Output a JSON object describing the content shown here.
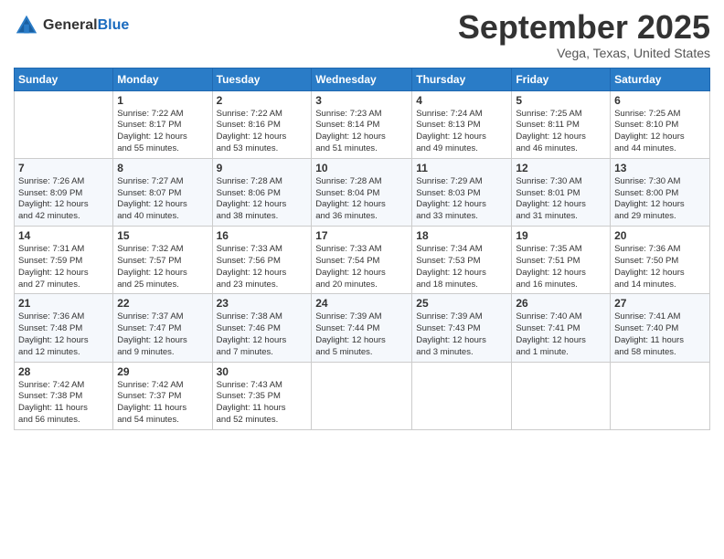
{
  "header": {
    "logo": {
      "general": "General",
      "blue": "Blue"
    },
    "title": "September 2025",
    "location": "Vega, Texas, United States"
  },
  "days_of_week": [
    "Sunday",
    "Monday",
    "Tuesday",
    "Wednesday",
    "Thursday",
    "Friday",
    "Saturday"
  ],
  "weeks": [
    [
      {
        "day": "",
        "info": ""
      },
      {
        "day": "1",
        "info": "Sunrise: 7:22 AM\nSunset: 8:17 PM\nDaylight: 12 hours\nand 55 minutes."
      },
      {
        "day": "2",
        "info": "Sunrise: 7:22 AM\nSunset: 8:16 PM\nDaylight: 12 hours\nand 53 minutes."
      },
      {
        "day": "3",
        "info": "Sunrise: 7:23 AM\nSunset: 8:14 PM\nDaylight: 12 hours\nand 51 minutes."
      },
      {
        "day": "4",
        "info": "Sunrise: 7:24 AM\nSunset: 8:13 PM\nDaylight: 12 hours\nand 49 minutes."
      },
      {
        "day": "5",
        "info": "Sunrise: 7:25 AM\nSunset: 8:11 PM\nDaylight: 12 hours\nand 46 minutes."
      },
      {
        "day": "6",
        "info": "Sunrise: 7:25 AM\nSunset: 8:10 PM\nDaylight: 12 hours\nand 44 minutes."
      }
    ],
    [
      {
        "day": "7",
        "info": "Sunrise: 7:26 AM\nSunset: 8:09 PM\nDaylight: 12 hours\nand 42 minutes."
      },
      {
        "day": "8",
        "info": "Sunrise: 7:27 AM\nSunset: 8:07 PM\nDaylight: 12 hours\nand 40 minutes."
      },
      {
        "day": "9",
        "info": "Sunrise: 7:28 AM\nSunset: 8:06 PM\nDaylight: 12 hours\nand 38 minutes."
      },
      {
        "day": "10",
        "info": "Sunrise: 7:28 AM\nSunset: 8:04 PM\nDaylight: 12 hours\nand 36 minutes."
      },
      {
        "day": "11",
        "info": "Sunrise: 7:29 AM\nSunset: 8:03 PM\nDaylight: 12 hours\nand 33 minutes."
      },
      {
        "day": "12",
        "info": "Sunrise: 7:30 AM\nSunset: 8:01 PM\nDaylight: 12 hours\nand 31 minutes."
      },
      {
        "day": "13",
        "info": "Sunrise: 7:30 AM\nSunset: 8:00 PM\nDaylight: 12 hours\nand 29 minutes."
      }
    ],
    [
      {
        "day": "14",
        "info": "Sunrise: 7:31 AM\nSunset: 7:59 PM\nDaylight: 12 hours\nand 27 minutes."
      },
      {
        "day": "15",
        "info": "Sunrise: 7:32 AM\nSunset: 7:57 PM\nDaylight: 12 hours\nand 25 minutes."
      },
      {
        "day": "16",
        "info": "Sunrise: 7:33 AM\nSunset: 7:56 PM\nDaylight: 12 hours\nand 23 minutes."
      },
      {
        "day": "17",
        "info": "Sunrise: 7:33 AM\nSunset: 7:54 PM\nDaylight: 12 hours\nand 20 minutes."
      },
      {
        "day": "18",
        "info": "Sunrise: 7:34 AM\nSunset: 7:53 PM\nDaylight: 12 hours\nand 18 minutes."
      },
      {
        "day": "19",
        "info": "Sunrise: 7:35 AM\nSunset: 7:51 PM\nDaylight: 12 hours\nand 16 minutes."
      },
      {
        "day": "20",
        "info": "Sunrise: 7:36 AM\nSunset: 7:50 PM\nDaylight: 12 hours\nand 14 minutes."
      }
    ],
    [
      {
        "day": "21",
        "info": "Sunrise: 7:36 AM\nSunset: 7:48 PM\nDaylight: 12 hours\nand 12 minutes."
      },
      {
        "day": "22",
        "info": "Sunrise: 7:37 AM\nSunset: 7:47 PM\nDaylight: 12 hours\nand 9 minutes."
      },
      {
        "day": "23",
        "info": "Sunrise: 7:38 AM\nSunset: 7:46 PM\nDaylight: 12 hours\nand 7 minutes."
      },
      {
        "day": "24",
        "info": "Sunrise: 7:39 AM\nSunset: 7:44 PM\nDaylight: 12 hours\nand 5 minutes."
      },
      {
        "day": "25",
        "info": "Sunrise: 7:39 AM\nSunset: 7:43 PM\nDaylight: 12 hours\nand 3 minutes."
      },
      {
        "day": "26",
        "info": "Sunrise: 7:40 AM\nSunset: 7:41 PM\nDaylight: 12 hours\nand 1 minute."
      },
      {
        "day": "27",
        "info": "Sunrise: 7:41 AM\nSunset: 7:40 PM\nDaylight: 11 hours\nand 58 minutes."
      }
    ],
    [
      {
        "day": "28",
        "info": "Sunrise: 7:42 AM\nSunset: 7:38 PM\nDaylight: 11 hours\nand 56 minutes."
      },
      {
        "day": "29",
        "info": "Sunrise: 7:42 AM\nSunset: 7:37 PM\nDaylight: 11 hours\nand 54 minutes."
      },
      {
        "day": "30",
        "info": "Sunrise: 7:43 AM\nSunset: 7:35 PM\nDaylight: 11 hours\nand 52 minutes."
      },
      {
        "day": "",
        "info": ""
      },
      {
        "day": "",
        "info": ""
      },
      {
        "day": "",
        "info": ""
      },
      {
        "day": "",
        "info": ""
      }
    ]
  ]
}
